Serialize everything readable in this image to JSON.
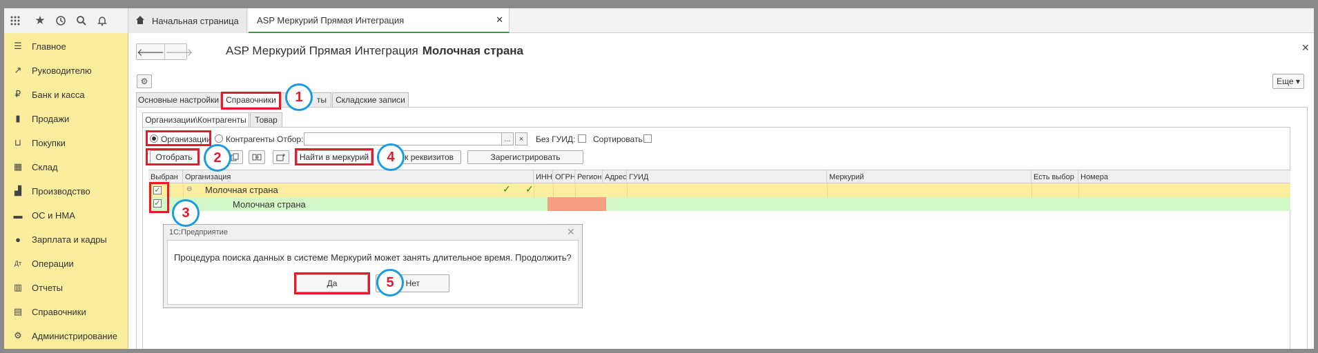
{
  "tabs": {
    "home": "Начальная страница",
    "active": "ASP Меркурий Прямая Интеграция",
    "close_glyph": "✕"
  },
  "sidebar": {
    "items": [
      {
        "label": "Главное",
        "icon": "list-icon",
        "glyph": "☰"
      },
      {
        "label": "Руководителю",
        "icon": "trend-icon",
        "glyph": "↗"
      },
      {
        "label": "Банк и касса",
        "icon": "ruble-icon",
        "glyph": "₽"
      },
      {
        "label": "Продажи",
        "icon": "bag-icon",
        "glyph": "▮"
      },
      {
        "label": "Покупки",
        "icon": "cart-icon",
        "glyph": "⊔"
      },
      {
        "label": "Склад",
        "icon": "warehouse-icon",
        "glyph": "▦"
      },
      {
        "label": "Производство",
        "icon": "factory-icon",
        "glyph": "▟"
      },
      {
        "label": "ОС и НМА",
        "icon": "truck-icon",
        "glyph": "▬"
      },
      {
        "label": "Зарплата и кадры",
        "icon": "person-icon",
        "glyph": "●"
      },
      {
        "label": "Операции",
        "icon": "debit-credit-icon",
        "glyph": "Дт"
      },
      {
        "label": "Отчеты",
        "icon": "bar-chart-icon",
        "glyph": "▥"
      },
      {
        "label": "Справочники",
        "icon": "book-icon",
        "glyph": "▤"
      },
      {
        "label": "Администрирование",
        "icon": "gear-icon",
        "glyph": "⚙"
      }
    ]
  },
  "form": {
    "title": "ASP Меркурий Прямая Интеграция",
    "subtitle": "Молочная страна",
    "more_label": "Еще ▾"
  },
  "tabrow1": [
    "Основные настройки",
    "Справочники",
    "ты",
    "Складские записи"
  ],
  "tabrow2": [
    "Организации\\Контрагенты",
    "Товар"
  ],
  "filter": {
    "radio_org": "Организации",
    "radio_contr": "Контрагенты",
    "otbor": "Отбор:",
    "otbor_value": "",
    "ellipsis": "...",
    "clear": "×",
    "no_guid": "Без ГУИД:",
    "sort": "Сортировать:"
  },
  "buttons": {
    "otobrat": "Отобрать",
    "find": "Найти в меркурий",
    "requisites": "к реквизитов",
    "register": "Зарегистрировать"
  },
  "table": {
    "headers": [
      "Выбран",
      "Организация",
      "ИНН",
      "ОГРН",
      "Регион",
      "Адрес",
      "ГУИД",
      "Меркурий",
      "Есть выбор",
      "Номера"
    ],
    "rows": [
      {
        "org": "Молочная страна",
        "group_marker": "⊖"
      },
      {
        "org": "Молочная страна"
      }
    ]
  },
  "dialog": {
    "title": "1С:Предприятие",
    "message": "Процедура поиска данных в системе Меркурий может занять длительное время. Продолжить?",
    "yes": "Да",
    "no": "Нет"
  },
  "annotations": [
    "1",
    "2",
    "3",
    "4",
    "5"
  ],
  "colors": {
    "sidebar": "#fbed9e",
    "row_group": "#fbee9f",
    "row_item": "#d3f8c8",
    "annotation_red": "#e8192c",
    "annotation_blue": "#1a9be0"
  }
}
